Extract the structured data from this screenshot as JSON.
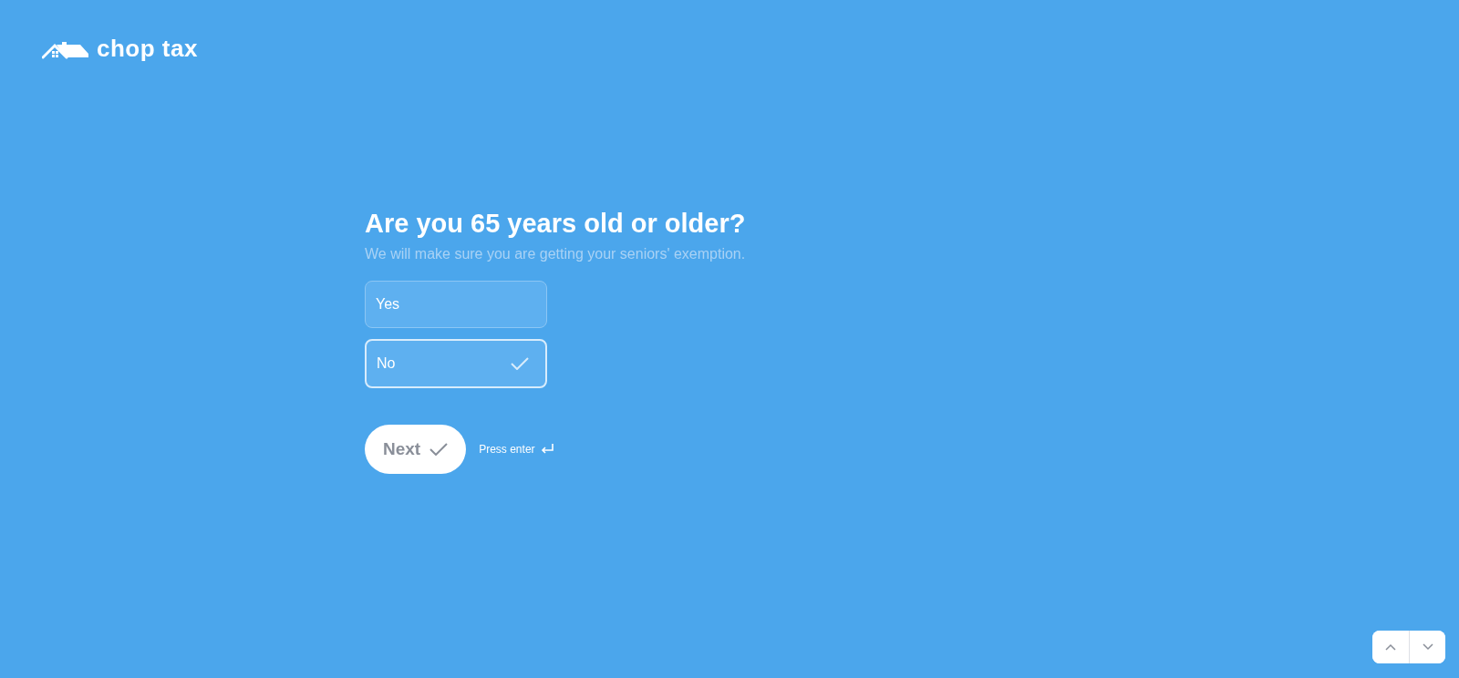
{
  "logo": {
    "text": "chop tax"
  },
  "question": {
    "title": "Are you 65 years old or older?",
    "subtitle": "We will make sure you are getting your seniors' exemption."
  },
  "options": [
    {
      "label": "Yes",
      "selected": false
    },
    {
      "label": "No",
      "selected": true
    }
  ],
  "next_button": {
    "label": "Next"
  },
  "hint": "Press enter"
}
